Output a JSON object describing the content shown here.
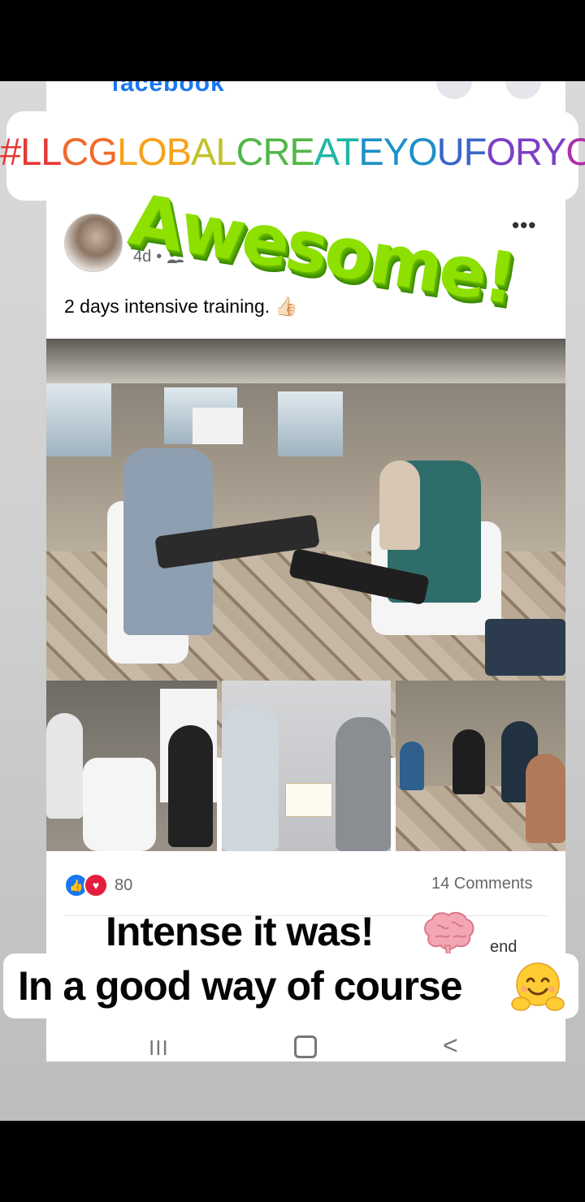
{
  "brand": "facebook",
  "overlay": {
    "hashtag": "#LLCGLOBALCREATEYOUFORYOU",
    "hashtag_colors": [
      "#e53935",
      "#f06a2c",
      "#f6a21c",
      "#c0c22a",
      "#52b748",
      "#1fb6a4",
      "#1e90c8",
      "#3a66c9",
      "#7b3fc6",
      "#b02ea8"
    ],
    "sticker": "Awesome!",
    "line1": "Intense it was!",
    "line2": "In a good way of course"
  },
  "post": {
    "time": "4d",
    "audience_icon": "friends-icon",
    "caption": "2 days intensive training.",
    "caption_emoji": "👍🏻",
    "menu_icon": "more-options-icon",
    "reactions": {
      "count": "80",
      "types": [
        "like",
        "love"
      ]
    },
    "comments": "14 Comments",
    "send_partial": "end"
  },
  "nav": {
    "recent_glyph": "III",
    "back_glyph": "<"
  }
}
